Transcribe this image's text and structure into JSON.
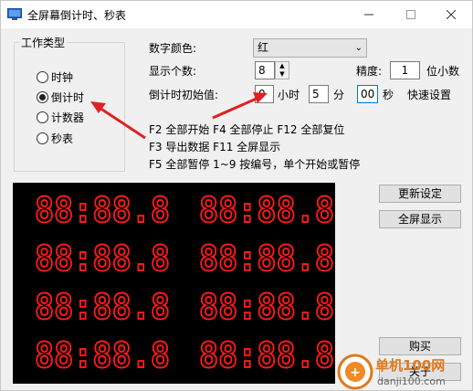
{
  "title": "全屏幕倒计时、秒表",
  "group": {
    "title": "工作类型",
    "options": [
      "时钟",
      "倒计时",
      "计数器",
      "秒表"
    ],
    "selected": 1
  },
  "settings": {
    "color_label": "数字颜色:",
    "color_value": "红",
    "count_label": "显示个数:",
    "count_value": "8",
    "precision_label": "精度:",
    "precision_value": "1",
    "precision_unit": "位小数",
    "initial_label": "倒计时初始值:",
    "hours_value": "0",
    "hours_unit": "小时",
    "minutes_value": "5",
    "minutes_unit": "分",
    "seconds_value": "00",
    "seconds_unit": "秒",
    "quick_setting": "快速设置"
  },
  "help": [
    "F2 全部开始 F4 全部停止 F12 全部复位",
    "F3 导出数据 F11 全屏显示",
    "F5 全部暂停 1~9 按编号，单个开始或暂停"
  ],
  "buttons": {
    "update": "更新设定",
    "fullscreen": "全屏显示",
    "buy": "购买",
    "about": "关于"
  },
  "display": {
    "digit_text": "88:88.8",
    "color": "#ff1a1a",
    "count": 8
  },
  "watermark": {
    "name": "单机100网",
    "url": "danji100.com"
  },
  "colors": {
    "annotation_arrow": "#e02020",
    "focus_border": "#0078d7"
  }
}
